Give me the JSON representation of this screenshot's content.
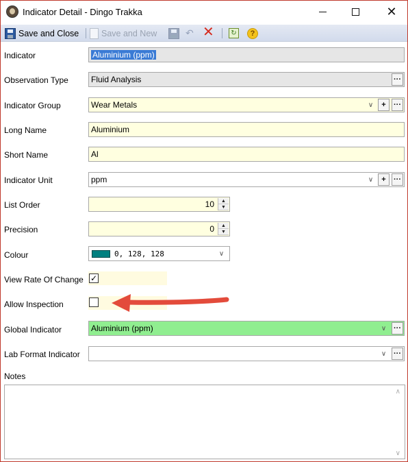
{
  "window": {
    "title": "Indicator Detail - Dingo Trakka",
    "min_glyph": "—",
    "close_glyph": "✕",
    "icons": {
      "app": "dingo-logo-icon",
      "minimize": "minimize-icon",
      "maximize": "maximize-icon",
      "close": "close-icon"
    }
  },
  "toolbar": {
    "save_close_label": "Save and Close",
    "save_new_label": "Save and New",
    "undo_glyph": "↶",
    "delete_glyph": "✕",
    "refresh_glyph": "↻",
    "help_glyph": "?",
    "icons": {
      "save": "floppy-disk-icon",
      "new": "new-document-icon",
      "undo": "undo-icon",
      "delete": "delete-x-icon",
      "refresh": "refresh-icon",
      "help": "help-icon"
    },
    "colors": {
      "delete": "#d52b1e",
      "help": "#f3c21c"
    }
  },
  "form": {
    "indicator": {
      "label": "Indicator",
      "value": "Aluminium (ppm)"
    },
    "observation_type": {
      "label": "Observation Type",
      "value": "Fluid Analysis"
    },
    "indicator_group": {
      "label": "Indicator Group",
      "value": "Wear Metals"
    },
    "long_name": {
      "label": "Long Name",
      "value": "Aluminium"
    },
    "short_name": {
      "label": "Short Name",
      "value": "Al"
    },
    "indicator_unit": {
      "label": "Indicator Unit",
      "value": "ppm"
    },
    "list_order": {
      "label": "List Order",
      "value": "10"
    },
    "precision": {
      "label": "Precision",
      "value": "0"
    },
    "colour": {
      "label": "Colour",
      "value": "0, 128, 128",
      "swatch": "#008080"
    },
    "view_rate_of_change": {
      "label": "View Rate Of Change",
      "checked": true,
      "check_glyph": "✓"
    },
    "allow_inspection": {
      "label": "Allow Inspection",
      "checked": false
    },
    "global_indicator": {
      "label": "Global Indicator",
      "value": "Aluminium (ppm)",
      "bg": "#90ee90"
    },
    "lab_format_indicator": {
      "label": "Lab Format Indicator",
      "value": ""
    },
    "notes": {
      "label": "Notes",
      "value": ""
    }
  },
  "buttons": {
    "ellipsis": "···",
    "add": "+",
    "chevron": "∨",
    "spin_up": "▲",
    "spin_down": "▼",
    "scroll_up": "∧",
    "scroll_down": "∨"
  },
  "annotation": {
    "arrow_color": "#e34b3b",
    "arrow_target": "allow_inspection"
  }
}
